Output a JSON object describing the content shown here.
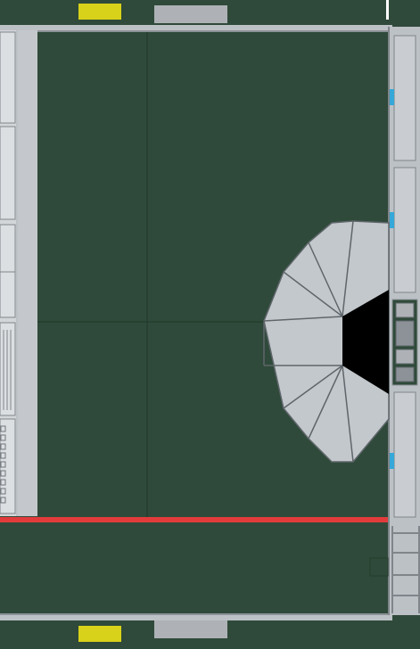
{
  "scene": {
    "kind": "top-down field / arena map",
    "palette": {
      "field": "#2e4a3a",
      "field_edge": "#26402f",
      "rail": "#bcc1c6",
      "rail_dark": "#8c9297",
      "panel": "#c9cdd1",
      "panel_line": "#7f858a",
      "hub": "#c3c8cc",
      "hub_edge": "#5f666b",
      "hub_core": "#000000",
      "marker_yellow": "#d9d21a",
      "marker_gray": "#aeb2b6",
      "boundary_red": "#e23b3b",
      "accent_blue": "#35a7d8"
    }
  },
  "markers": {
    "top_left_label": "",
    "top_right_label": "",
    "bottom_left_label": "",
    "bottom_right_label": ""
  }
}
